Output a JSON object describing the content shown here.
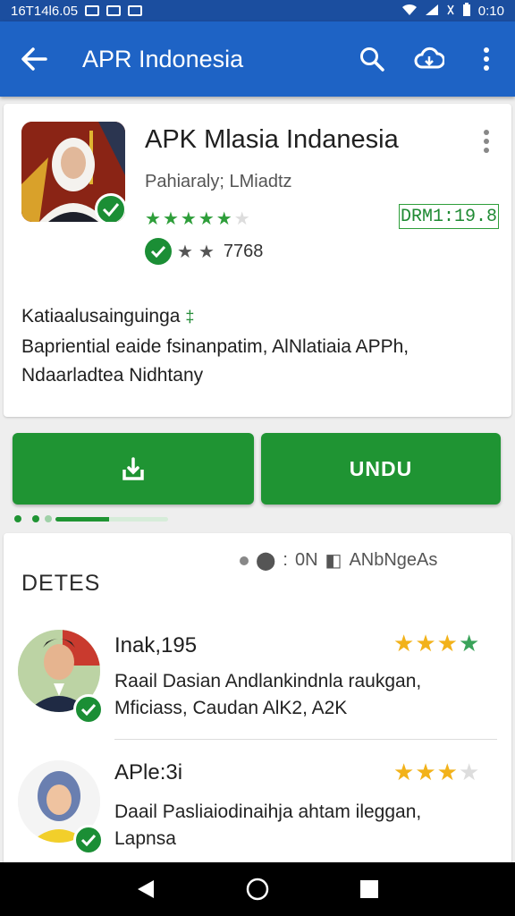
{
  "status_bar": {
    "left_text": "16T14l6.05",
    "time": "0:10"
  },
  "app_bar": {
    "title": "APR Indonesia"
  },
  "app_card": {
    "title": "APK Mlasia Indanesia",
    "developer": "Pahiaraly; LMiadtz",
    "rating_stars": 5,
    "rating_filled": 5,
    "price": "DRM1:19.8",
    "meta_count": "7768",
    "description_heading": "Katiaalusainguinga",
    "description_mark": "‡",
    "description_lines": [
      "Bapriential eaide fsinanpatim, AlNlatiaia APPh,",
      "Ndaarladtea Nidhtany"
    ]
  },
  "buttons": {
    "download_icon": "download-icon",
    "primary_label": "UNDU"
  },
  "progress": {
    "fraction": 0.48
  },
  "reviews": {
    "section_title": "DETES",
    "filter_text": "0N",
    "filter_label": "ANbNgeAs",
    "items": [
      {
        "name": "Inak,195",
        "stars_filled": 4,
        "stars_total": 4,
        "lines": [
          "Raail Dasian Andlankindnla raukgan,",
          "Mficiass, Caudan AlK2, A2K"
        ]
      },
      {
        "name": "APle:3i",
        "stars_filled": 3,
        "stars_total": 4,
        "lines": [
          "Daail Pasliaiodinaihja ahtam ileggan,",
          "Lapnsa"
        ]
      }
    ]
  },
  "colors": {
    "app_bar": "#1e63c5",
    "status_bar": "#1b4e9f",
    "accent_green": "#1f9433",
    "star_gold": "#f2b21a"
  }
}
